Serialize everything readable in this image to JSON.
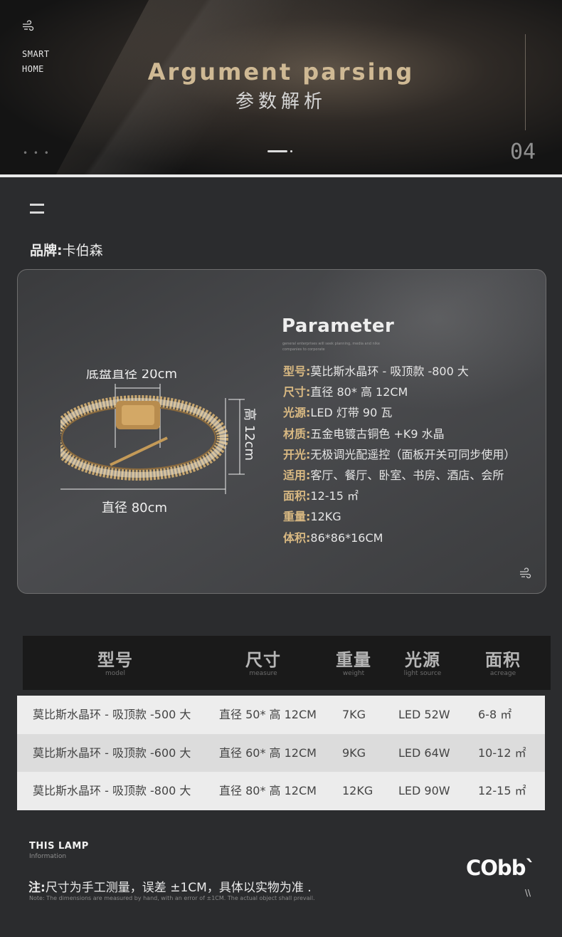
{
  "header": {
    "nav_line1": "SMART",
    "nav_line2": "HOME",
    "title_en": "Argument parsing",
    "title_cn": "参数解析",
    "dots": "• • •",
    "page_number": "04"
  },
  "brand": {
    "label": "品牌:",
    "value": "卡伯森"
  },
  "diagram": {
    "base_label": "底盘直径 20cm",
    "height_label": "高 12cm",
    "diameter_label": "直径 80cm"
  },
  "parameter": {
    "title": "Parameter",
    "subtitle": "general enterprises will seek planning, media and nike companies to corporate",
    "specs": [
      {
        "key": "型号:",
        "value": "莫比斯水晶环 - 吸顶款 -800 大"
      },
      {
        "key": "尺寸:",
        "value": "直径 80* 高 12CM"
      },
      {
        "key": "光源:",
        "value": "LED 灯带 90 瓦"
      },
      {
        "key": "材质:",
        "value": "五金电镀古铜色 +K9 水晶"
      },
      {
        "key": "开光:",
        "value": "无极调光配遥控（面板开关可同步使用）"
      },
      {
        "key": "适用:",
        "value": "客厅、餐厅、卧室、书房、酒店、会所"
      },
      {
        "key": "面积:",
        "value": "12-15 ㎡"
      },
      {
        "key": "重量:",
        "value": "12KG"
      },
      {
        "key": "体积:",
        "value": "86*86*16CM"
      }
    ]
  },
  "table": {
    "headers": [
      {
        "cn": "型号",
        "en": "model"
      },
      {
        "cn": "尺寸",
        "en": "measure"
      },
      {
        "cn": "重量",
        "en": "weight"
      },
      {
        "cn": "光源",
        "en": "light source"
      },
      {
        "cn": "面积",
        "en": "acreage"
      }
    ],
    "rows": [
      [
        "莫比斯水晶环 - 吸顶款 -500 大",
        "直径 50* 高 12CM",
        "7KG",
        "LED  52W",
        "6-8 ㎡"
      ],
      [
        "莫比斯水晶环 - 吸顶款 -600 大",
        "直径 60* 高 12CM",
        "9KG",
        "LED  64W",
        "10-12 ㎡"
      ],
      [
        "莫比斯水晶环 - 吸顶款 -800 大",
        "直径 80* 高 12CM",
        "12KG",
        "LED  90W",
        "12-15 ㎡"
      ]
    ]
  },
  "footer": {
    "this_lamp": "THIS LAMP",
    "information": "Information",
    "note_label": "注:",
    "note_text": "尺寸为手工测量，误差 ±1CM，具体以实物为准 .",
    "note_en": "Note: The dimensions are measured by hand, with an error of ±1CM. The actual object shall prevail.",
    "logo": "CObb`",
    "slashes": "\\\\"
  },
  "colors": {
    "gold": "#d9b982",
    "title_gold": "#cfb994",
    "dark_bg": "#2b2c2e"
  }
}
